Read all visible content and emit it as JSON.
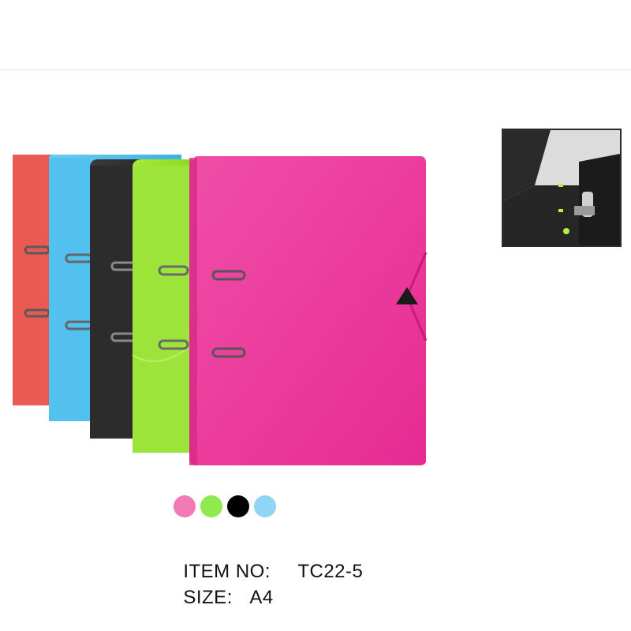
{
  "product": {
    "item_label": "ITEM NO:",
    "item_value": "TC22-5",
    "size_label": "SIZE:",
    "size_value": "A4"
  },
  "colors": {
    "red": "#e8524b",
    "blue": "#5bbfea",
    "black": "#262626",
    "green": "#9be22f",
    "pink": "#ee3b9d"
  },
  "swatches": [
    {
      "name": "pink",
      "color": "#f27ab6"
    },
    {
      "name": "green",
      "color": "#8fea4e"
    },
    {
      "name": "black",
      "color": "#000000"
    },
    {
      "name": "light-blue",
      "color": "#8fd5f5"
    }
  ]
}
